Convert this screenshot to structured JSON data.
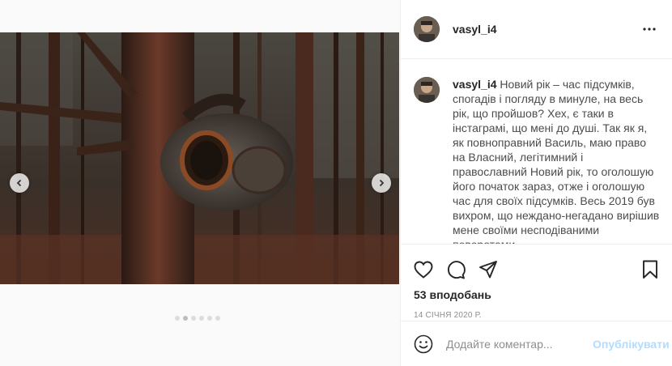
{
  "post": {
    "username": "vasyl_i4",
    "caption_user": "vasyl_i4",
    "caption": " Новий рік – час підсумків, спогадів і погляду в минуле, на весь рік, що пройшов? Хех, є таки в інстаграмі, що мені до душі. Так як я, як повноправний Василь, маю право на Власний, легітимний і православний Новий рік, то оголошую його початок зараз, отже і оголошую час для своїх підсумків. Весь 2019 був вихром, що неждано-негадано вирішив мене своїми несподіваними поворотами",
    "likes": "53 вподобань",
    "date": "14 СІЧНЯ 2020 Р."
  },
  "comment": {
    "placeholder": "Додайте коментар...",
    "post_label": "Опублікувати"
  },
  "icons": {
    "more": "more-options-icon",
    "like": "heart-icon",
    "comment": "comment-icon",
    "share": "share-icon",
    "save": "bookmark-icon",
    "emoji": "emoji-icon",
    "prev": "chevron-left-icon",
    "next": "chevron-right-icon"
  },
  "carousel": {
    "slides": 6,
    "active": 1
  }
}
